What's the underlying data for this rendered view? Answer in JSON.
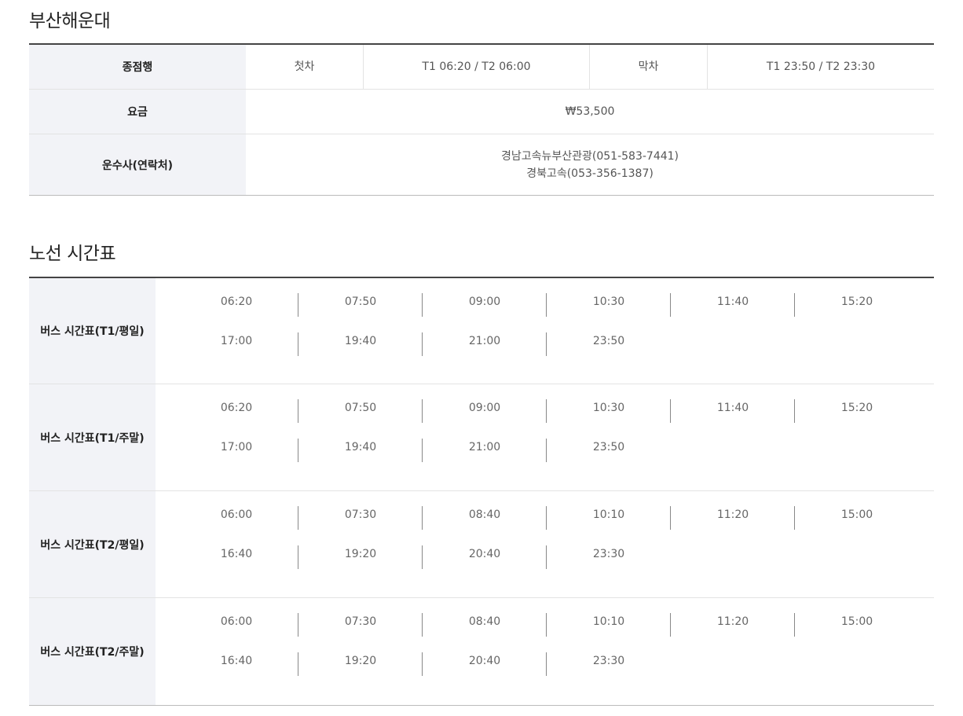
{
  "section1": {
    "title": "부산해운대",
    "rows": {
      "terminal_label": "종점행",
      "first_label": "첫차",
      "first_value": "T1 06:20 / T2 06:00",
      "last_label": "막차",
      "last_value": "T1 23:50 / T2 23:30",
      "fare_label": "요금",
      "fare_value": "₩53,500",
      "operator_label": "운수사(연락처)",
      "operator_1": "경남고속뉴부산관광(051-583-7441)",
      "operator_2": "경북고속(053-356-1387)"
    }
  },
  "section2": {
    "title": "노선 시간표",
    "schedules": [
      {
        "label": "버스 시간표(T1/평일)",
        "lines": [
          [
            "06:20",
            "07:50",
            "09:00",
            "10:30",
            "11:40",
            "15:20"
          ],
          [
            "17:00",
            "19:40",
            "21:00",
            "23:50"
          ]
        ]
      },
      {
        "label": "버스 시간표(T1/주말)",
        "lines": [
          [
            "06:20",
            "07:50",
            "09:00",
            "10:30",
            "11:40",
            "15:20"
          ],
          [
            "17:00",
            "19:40",
            "21:00",
            "23:50"
          ]
        ]
      },
      {
        "label": "버스 시간표(T2/평일)",
        "lines": [
          [
            "06:00",
            "07:30",
            "08:40",
            "10:10",
            "11:20",
            "15:00"
          ],
          [
            "16:40",
            "19:20",
            "20:40",
            "23:30"
          ]
        ]
      },
      {
        "label": "버스 시간표(T2/주말)",
        "lines": [
          [
            "06:00",
            "07:30",
            "08:40",
            "10:10",
            "11:20",
            "15:00"
          ],
          [
            "16:40",
            "19:20",
            "20:40",
            "23:30"
          ]
        ]
      }
    ]
  }
}
